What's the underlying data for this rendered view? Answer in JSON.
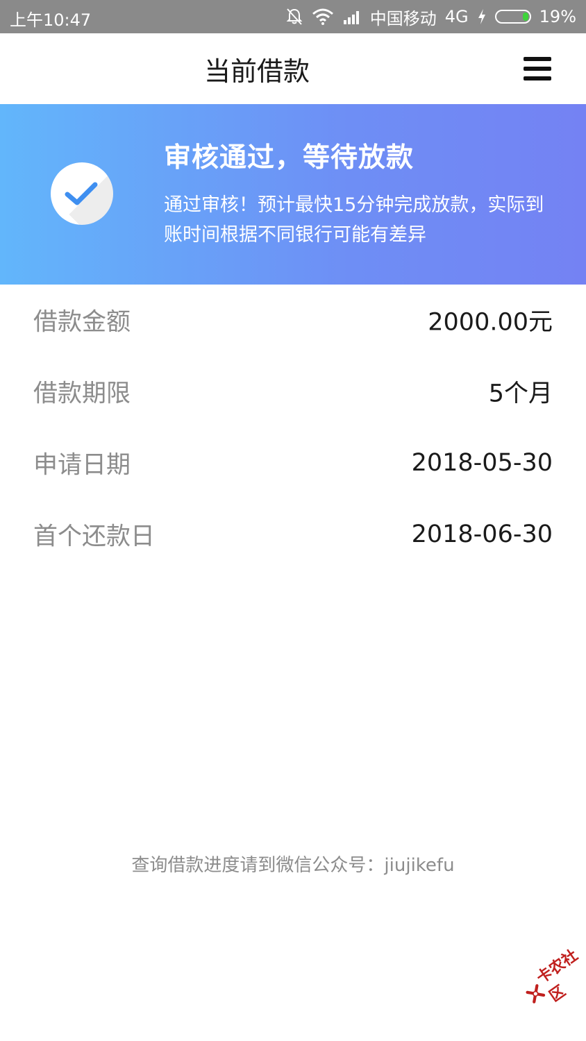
{
  "status_bar": {
    "time": "上午10:47",
    "carrier": "中国移动",
    "network": "4G",
    "battery_percent": "19%",
    "battery_level": 0.19,
    "icons": [
      "mute-bell-icon",
      "wifi-icon",
      "signal-icon",
      "charging-icon",
      "battery-icon"
    ]
  },
  "nav": {
    "title": "当前借款",
    "menu_icon": "hamburger-menu-icon"
  },
  "banner": {
    "title": "审核通过，等待放款",
    "description": "通过审核！预计最快15分钟完成放款，实际到账时间根据不同银行可能有差异",
    "icon": "check-circle-icon",
    "colors": {
      "gradient_start": "#62b6fb",
      "gradient_end": "#7482f3",
      "check": "#3f8ff0"
    }
  },
  "details": [
    {
      "label": "借款金额",
      "value": "2000.00元"
    },
    {
      "label": "借款期限",
      "value": "5个月"
    },
    {
      "label": "申请日期",
      "value": "2018-05-30"
    },
    {
      "label": "首个还款日",
      "value": "2018-06-30"
    }
  ],
  "footer": {
    "note": "查询借款进度请到微信公众号：jiujikefu"
  },
  "watermark": {
    "text": "卡农社区",
    "icon": "kanong-logo-icon"
  }
}
